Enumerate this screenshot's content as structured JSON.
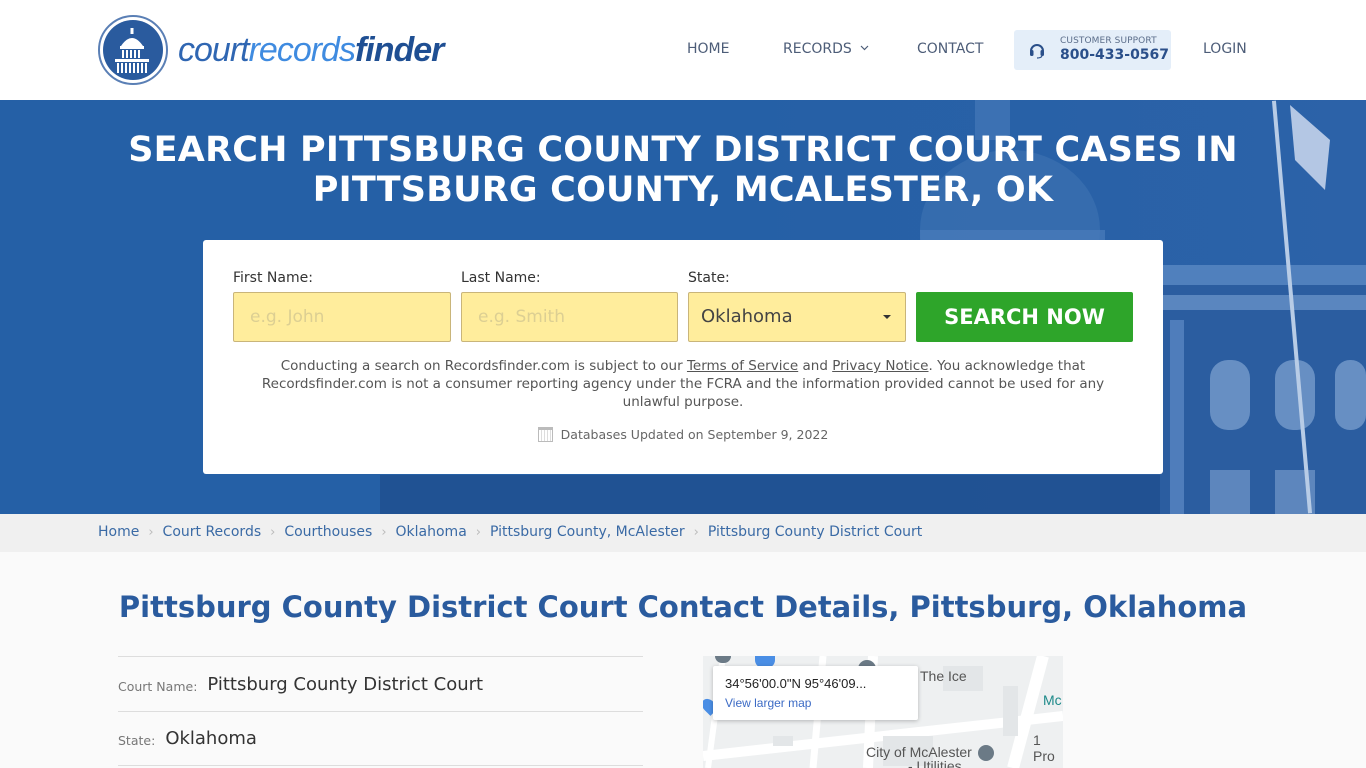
{
  "header": {
    "logo": {
      "part1": "court",
      "part2": "records",
      "part3": "finder"
    },
    "nav": {
      "home": "HOME",
      "records": "RECORDS",
      "contact": "CONTACT",
      "login": "LOGIN"
    },
    "support": {
      "label": "CUSTOMER SUPPORT",
      "phone": "800-433-0567"
    }
  },
  "hero": {
    "title_line1": "SEARCH PITTSBURG COUNTY DISTRICT COURT CASES IN",
    "title_line2": "PITTSBURG COUNTY, MCALESTER, OK",
    "form": {
      "first_name_label": "First Name:",
      "first_name_placeholder": "e.g. John",
      "first_name_value": "",
      "last_name_label": "Last Name:",
      "last_name_placeholder": "e.g. Smith",
      "last_name_value": "",
      "state_label": "State:",
      "state_selected": "Oklahoma",
      "search_button": "SEARCH NOW"
    },
    "disclaimer": {
      "part1": "Conducting a search on Recordsfinder.com is subject to our ",
      "terms_link": "Terms of Service",
      "part2": " and ",
      "privacy_link": "Privacy Notice",
      "part3": ". You acknowledge that Recordsfinder.com is not a consumer reporting agency under the FCRA and the information provided cannot be used for any unlawful purpose."
    },
    "db_updated": "Databases Updated on September 9, 2022"
  },
  "breadcrumb": [
    {
      "label": "Home"
    },
    {
      "label": "Court Records"
    },
    {
      "label": "Courthouses"
    },
    {
      "label": "Oklahoma"
    },
    {
      "label": "Pittsburg County, McAlester"
    },
    {
      "label": "Pittsburg County District Court"
    }
  ],
  "main": {
    "title": "Pittsburg County District Court Contact Details, Pittsburg, Oklahoma",
    "details": [
      {
        "label": "Court Name:",
        "value": "Pittsburg County District Court"
      },
      {
        "label": "State:",
        "value": "Oklahoma"
      }
    ]
  },
  "map": {
    "coords": "34°56'00.0\"N 95°46'09...",
    "view_larger": "View larger map",
    "labels": {
      "the_ice": "The Ice",
      "mc": "Mc",
      "one_pro": "1 Pro",
      "city_line1": "City of McAlester",
      "city_line2": "- Utilities"
    }
  },
  "colors": {
    "brand_blue": "#2560a6",
    "search_green": "#2ea52a",
    "input_yellow": "#ffed9c",
    "link_blue": "#3a6aa5"
  }
}
